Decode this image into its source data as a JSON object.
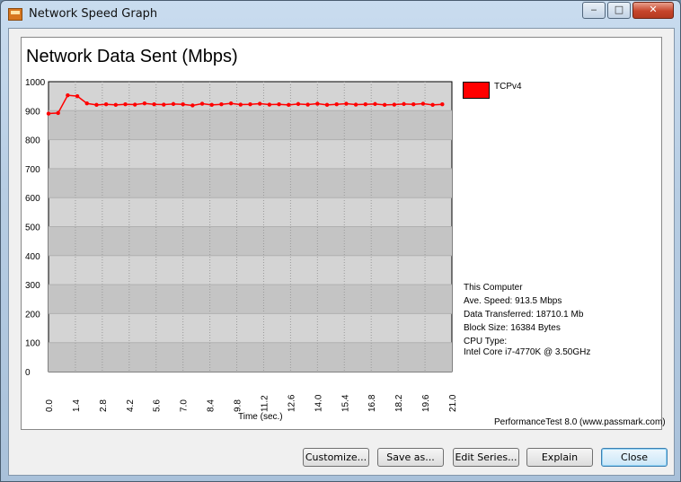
{
  "window": {
    "title": "Network Speed Graph",
    "controls": {
      "minimize": "‒",
      "maximize": "□",
      "close": "✕"
    }
  },
  "chart_data": {
    "type": "line",
    "title": "Network Data Sent (Mbps)",
    "xlabel": "Time (sec.)",
    "ylabel": "",
    "ylim": [
      0,
      1000
    ],
    "xlim": [
      0,
      21
    ],
    "yticks": [
      "0",
      "100",
      "200",
      "300",
      "400",
      "500",
      "600",
      "700",
      "800",
      "900",
      "1000"
    ],
    "xticks": [
      "0.0",
      "1.4",
      "2.8",
      "4.2",
      "5.6",
      "7.0",
      "8.4",
      "9.8",
      "11.2",
      "12.6",
      "14.0",
      "15.4",
      "16.8",
      "18.2",
      "19.6",
      "21.0"
    ],
    "grid": true,
    "legend_position": "top-right",
    "series": [
      {
        "name": "TCPv4",
        "color": "#ff0000",
        "x": [
          0.0,
          0.5,
          1.0,
          1.5,
          2.0,
          2.5,
          3.0,
          3.5,
          4.0,
          4.5,
          5.0,
          5.5,
          6.0,
          6.5,
          7.0,
          7.5,
          8.0,
          8.5,
          9.0,
          9.5,
          10.0,
          10.5,
          11.0,
          11.5,
          12.0,
          12.5,
          13.0,
          13.5,
          14.0,
          14.5,
          15.0,
          15.5,
          16.0,
          16.5,
          17.0,
          17.5,
          18.0,
          18.5,
          19.0,
          19.5,
          20.0,
          20.5
        ],
        "values": [
          890,
          892,
          953,
          950,
          925,
          920,
          922,
          920,
          922,
          921,
          925,
          922,
          921,
          923,
          922,
          918,
          924,
          920,
          922,
          925,
          921,
          922,
          924,
          921,
          922,
          920,
          923,
          921,
          924,
          920,
          922,
          924,
          921,
          922,
          923,
          920,
          921,
          923,
          922,
          924,
          920,
          922
        ]
      }
    ]
  },
  "info": {
    "computer": "This Computer",
    "speed": "Ave. Speed: 913.5 Mbps",
    "transferred": "Data Transferred: 18710.1 Mb",
    "block_size": "Block Size: 16384 Bytes",
    "cpu_label": "CPU Type:",
    "cpu_name": "Intel Core i7-4770K @ 3.50GHz"
  },
  "credit": "PerformanceTest 8.0 (www.passmark.com)",
  "buttons": {
    "customize": "Customize...",
    "save_as": "Save as...",
    "edit_series": "Edit Series...",
    "explain": "Explain",
    "close": "Close"
  }
}
